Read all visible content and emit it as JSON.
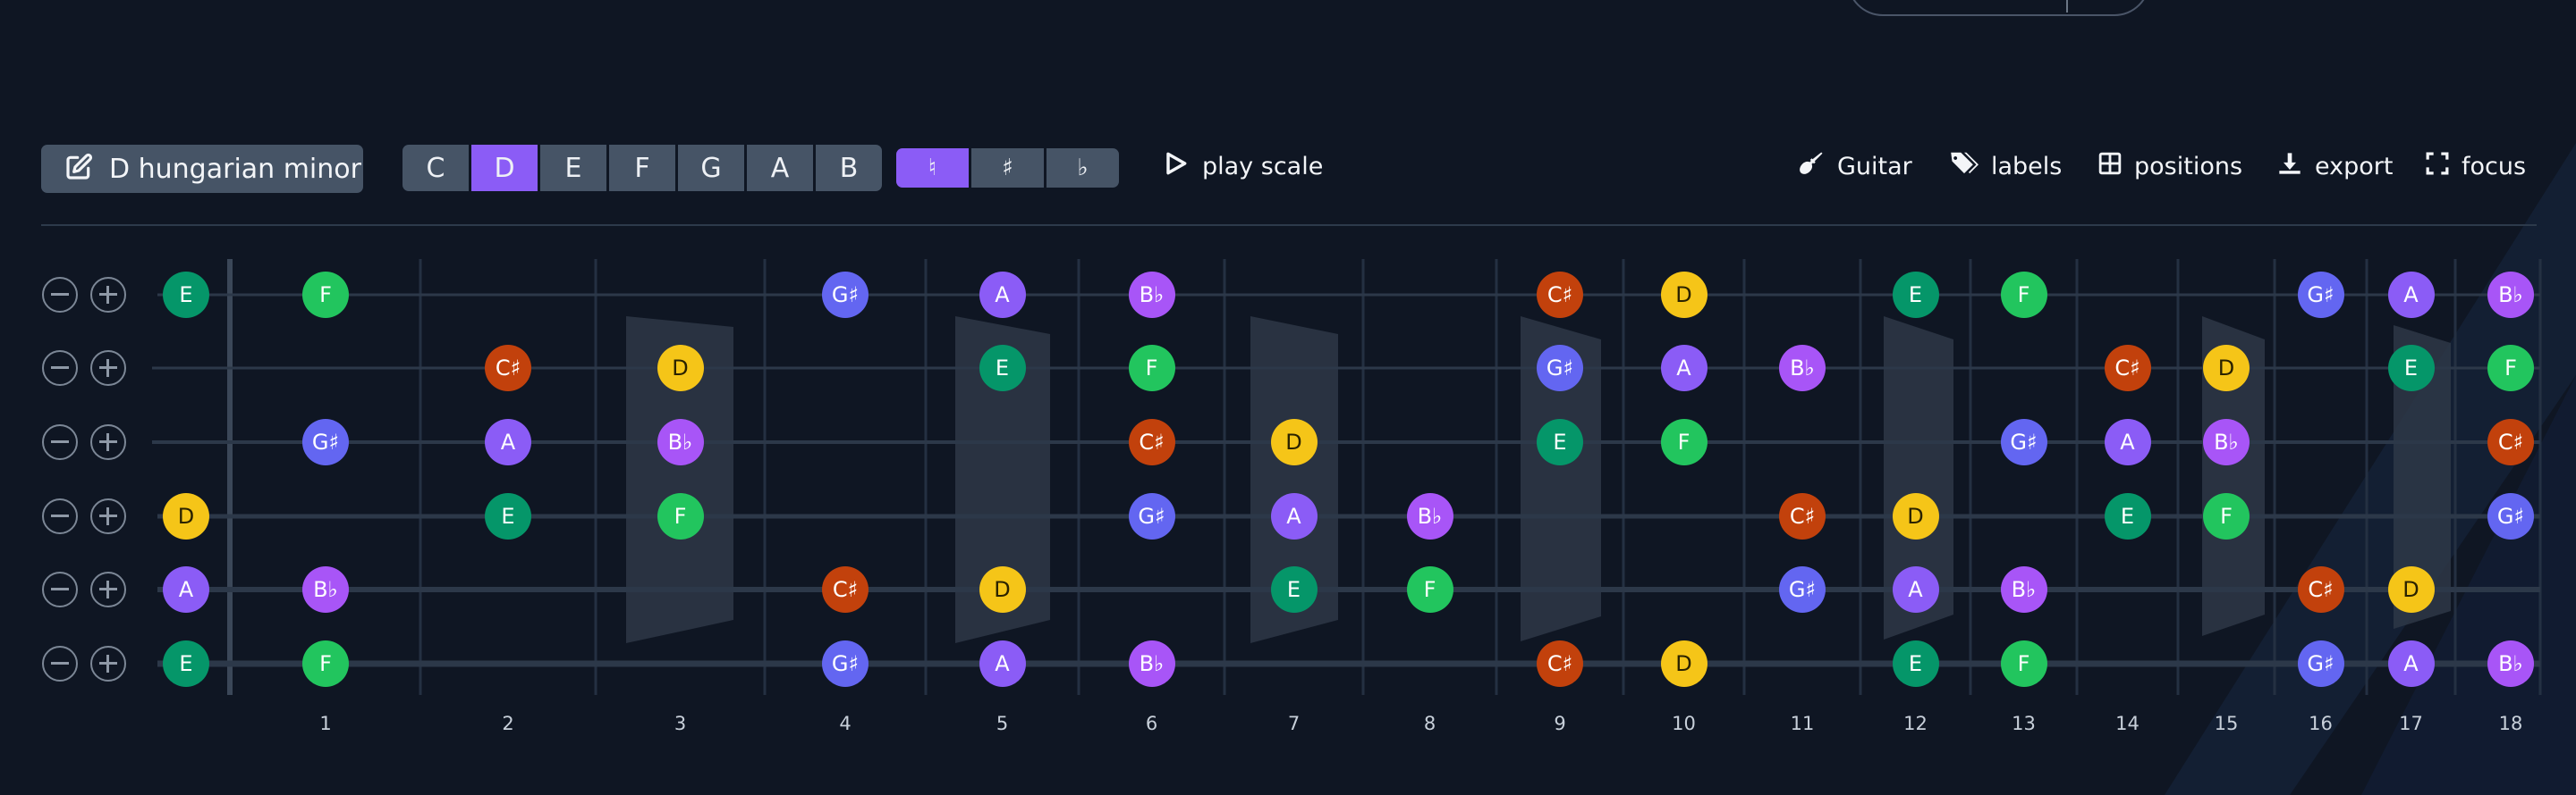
{
  "toolbar": {
    "scale_label": "D hungarian minor",
    "roots": [
      "C",
      "D",
      "E",
      "F",
      "G",
      "A",
      "B"
    ],
    "selected_root": "D",
    "accidentals": [
      "♮",
      "♯",
      "♭"
    ],
    "selected_accidental": "♮",
    "play_label": "play scale",
    "instrument_label": "Guitar",
    "labels_label": "labels",
    "positions_label": "positions",
    "export_label": "export",
    "focus_label": "focus"
  },
  "colors": {
    "background": "#0f1623",
    "accent": "#8b5cf6",
    "button": "#465466",
    "note_D": "#f5c518",
    "note_E": "#059669",
    "note_F": "#22c55e",
    "note_Gs": "#6366f1",
    "note_A": "#8b5cf6",
    "note_Bb": "#a855f7",
    "note_Cs": "#c2410c"
  },
  "fretboard": {
    "fret_numbers": [
      "1",
      "2",
      "3",
      "4",
      "5",
      "6",
      "7",
      "8",
      "9",
      "10",
      "11",
      "12",
      "13",
      "14",
      "15",
      "16",
      "17",
      "18"
    ],
    "strings": [
      {
        "open": "E",
        "notes": [
          "F",
          "",
          "",
          "G♯",
          "A",
          "B♭",
          "",
          "",
          "C♯",
          "D",
          "",
          "E",
          "F",
          "",
          "",
          "G♯",
          "A",
          "B♭"
        ]
      },
      {
        "open": "",
        "notes": [
          "",
          "C♯",
          "D",
          "",
          "E",
          "F",
          "",
          "",
          "G♯",
          "A",
          "B♭",
          "",
          "",
          "C♯",
          "D",
          "",
          "E",
          "F"
        ]
      },
      {
        "open": "",
        "notes": [
          "G♯",
          "A",
          "B♭",
          "",
          "",
          "C♯",
          "D",
          "",
          "E",
          "F",
          "",
          "",
          "G♯",
          "A",
          "B♭",
          "",
          "",
          "C♯"
        ]
      },
      {
        "open": "D",
        "notes": [
          "",
          "E",
          "F",
          "",
          "",
          "G♯",
          "A",
          "B♭",
          "",
          "",
          "C♯",
          "D",
          "",
          "E",
          "F",
          "",
          "",
          "G♯"
        ]
      },
      {
        "open": "A",
        "notes": [
          "B♭",
          "",
          "",
          "C♯",
          "D",
          "",
          "E",
          "F",
          "",
          "",
          "G♯",
          "A",
          "B♭",
          "",
          "",
          "C♯",
          "D",
          ""
        ]
      },
      {
        "open": "E",
        "notes": [
          "F",
          "",
          "",
          "G♯",
          "A",
          "B♭",
          "",
          "",
          "C♯",
          "D",
          "",
          "E",
          "F",
          "",
          "",
          "G♯",
          "A",
          "B♭"
        ]
      }
    ]
  }
}
